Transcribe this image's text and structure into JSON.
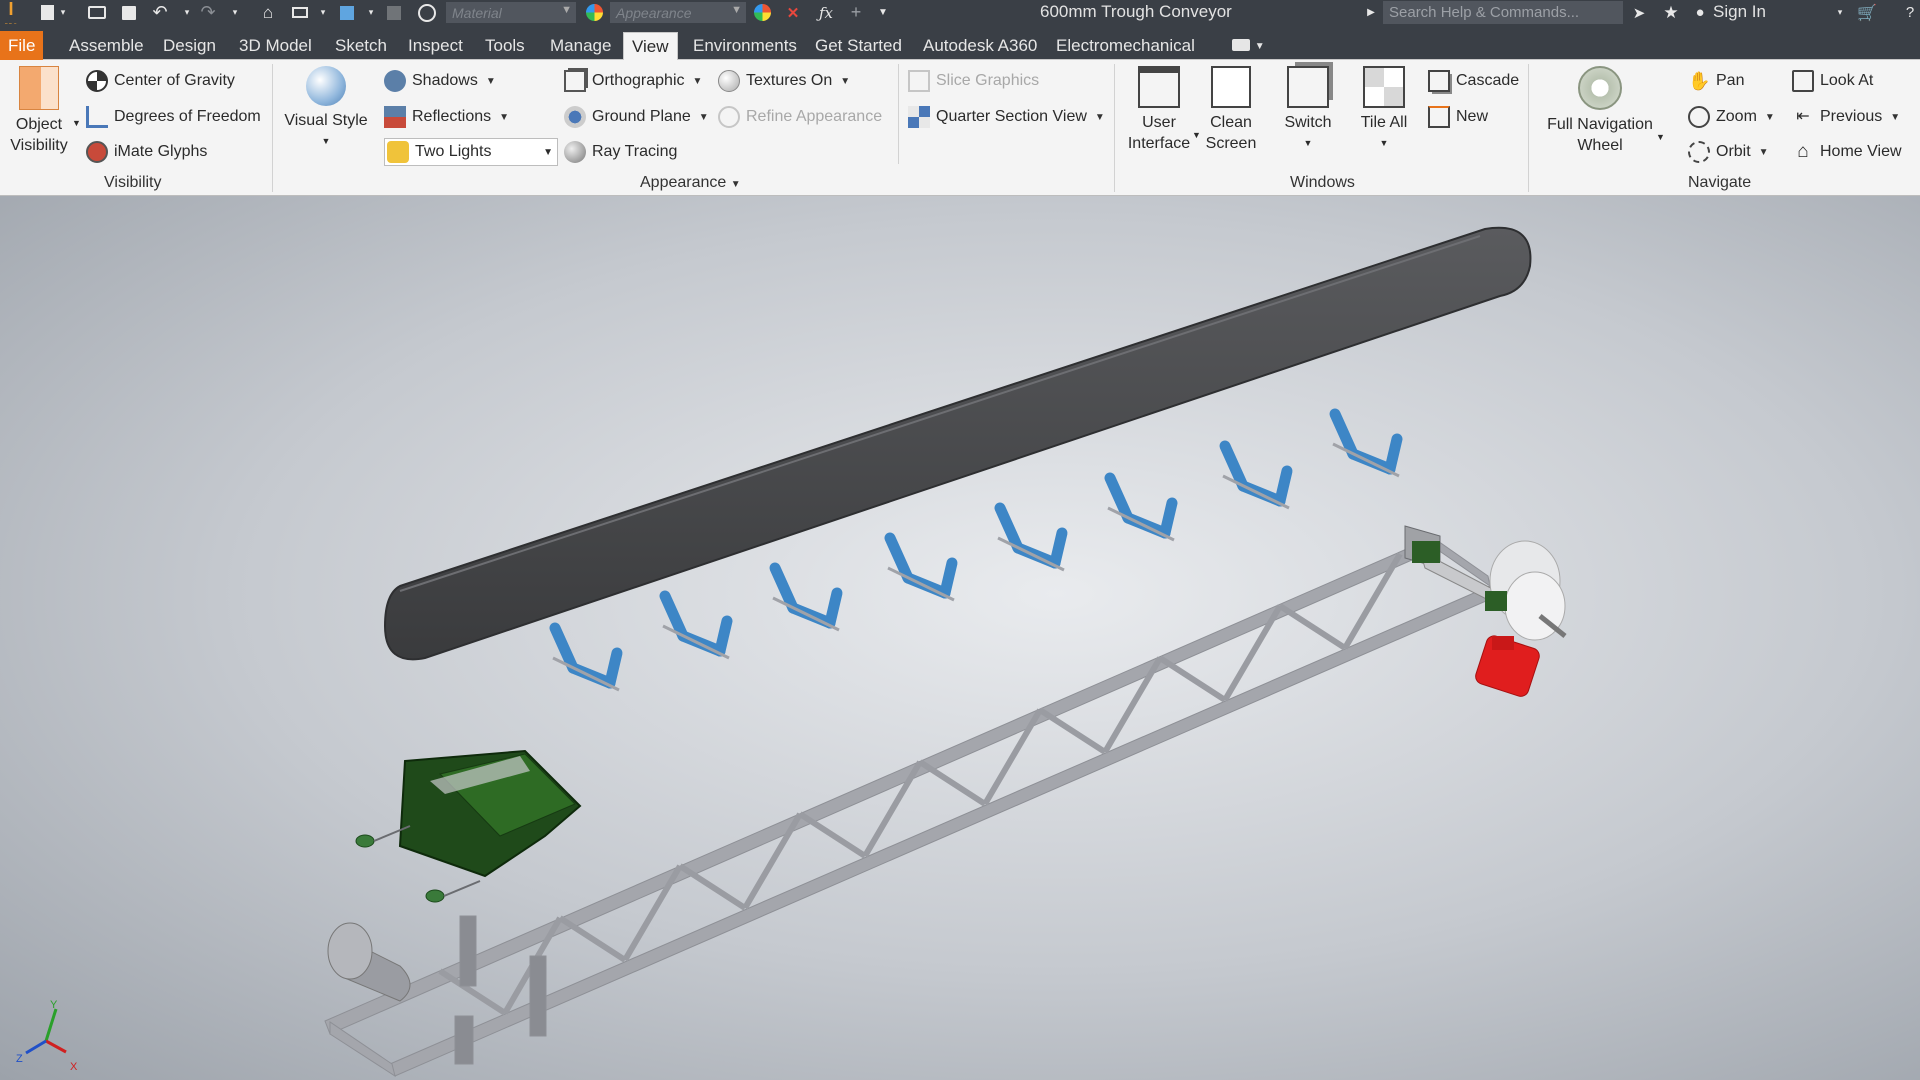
{
  "title_bar": {
    "document_title": "600mm Trough Conveyor",
    "material_placeholder": "Material",
    "appearance_placeholder": "Appearance",
    "search_placeholder": "Search Help & Commands...",
    "sign_in": "Sign In",
    "app_logo_letter": "I",
    "app_logo_sub": "PRO"
  },
  "tabs": {
    "file": "File",
    "items": [
      "Assemble",
      "Design",
      "3D Model",
      "Sketch",
      "Inspect",
      "Tools",
      "Manage",
      "View",
      "Environments",
      "Get Started",
      "Autodesk A360",
      "Electromechanical"
    ],
    "active": "View"
  },
  "ribbon": {
    "visibility": {
      "object_visibility_line1": "Object",
      "object_visibility_line2": "Visibility",
      "center_of_gravity": "Center of Gravity",
      "degrees_of_freedom": "Degrees of Freedom",
      "imate_glyphs": "iMate Glyphs",
      "panel": "Visibility"
    },
    "appearance": {
      "visual_style": "Visual Style",
      "shadows": "Shadows",
      "reflections": "Reflections",
      "lighting": "Two Lights",
      "orthographic": "Orthographic",
      "ground_plane": "Ground Plane",
      "ray_tracing": "Ray Tracing",
      "textures_on": "Textures On",
      "refine_appearance": "Refine Appearance",
      "slice_graphics": "Slice Graphics",
      "quarter_section_view": "Quarter Section View",
      "panel": "Appearance"
    },
    "windows": {
      "user_interface_line1": "User",
      "user_interface_line2": "Interface",
      "clean_screen_line1": "Clean",
      "clean_screen_line2": "Screen",
      "switch": "Switch",
      "tile_all": "Tile All",
      "cascade": "Cascade",
      "new": "New",
      "panel": "Windows"
    },
    "navigate": {
      "full_navigation_wheel_line1": "Full Navigation",
      "full_navigation_wheel_line2": "Wheel",
      "pan": "Pan",
      "zoom": "Zoom",
      "orbit": "Orbit",
      "look_at": "Look At",
      "previous": "Previous",
      "home_view": "Home View",
      "panel": "Navigate"
    }
  },
  "viewport": {
    "triad": {
      "x": "X",
      "y": "Y",
      "z": "Z"
    }
  },
  "colors": {
    "title_bar": "#3a3f46",
    "file_tab": "#e8731a",
    "ribbon": "#f4f4f4",
    "belt": "#4a4b4d",
    "frame": "#9ea0a6",
    "idler_roller": "#3d86c6",
    "hopper": "#1f4a1a",
    "motor": "#e01e1e"
  }
}
